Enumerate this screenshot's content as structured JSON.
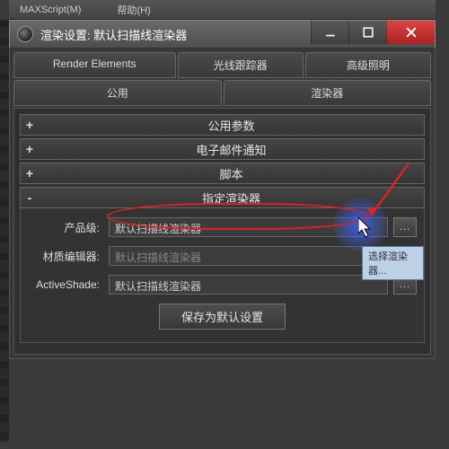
{
  "menubar": {
    "item1": "MAXScript(M)",
    "item2": "帮助(H)"
  },
  "window": {
    "title": "渲染设置: 默认扫描线渲染器"
  },
  "tabs": {
    "row1": [
      "Render Elements",
      "光线跟踪器",
      "高级照明"
    ],
    "row2": [
      "公用",
      "渲染器"
    ]
  },
  "rollouts": {
    "common_params": {
      "toggle": "+",
      "title": "公用参数"
    },
    "email": {
      "toggle": "+",
      "title": "电子邮件通知"
    },
    "scripts": {
      "toggle": "+",
      "title": "脚本"
    },
    "assign": {
      "toggle": "-",
      "title": "指定渲染器"
    }
  },
  "assign": {
    "rows": [
      {
        "label": "产品级:",
        "value": "默认扫描线渲染器",
        "dots": "...",
        "disabled": false
      },
      {
        "label": "材质编辑器:",
        "value": "默认扫描线渲染器",
        "dots": "...",
        "disabled": true
      },
      {
        "label": "ActiveShade:",
        "value": "默认扫描线渲染器",
        "dots": "...",
        "disabled": false
      }
    ],
    "save_button": "保存为默认设置"
  },
  "tooltip": "选择渲染器..."
}
